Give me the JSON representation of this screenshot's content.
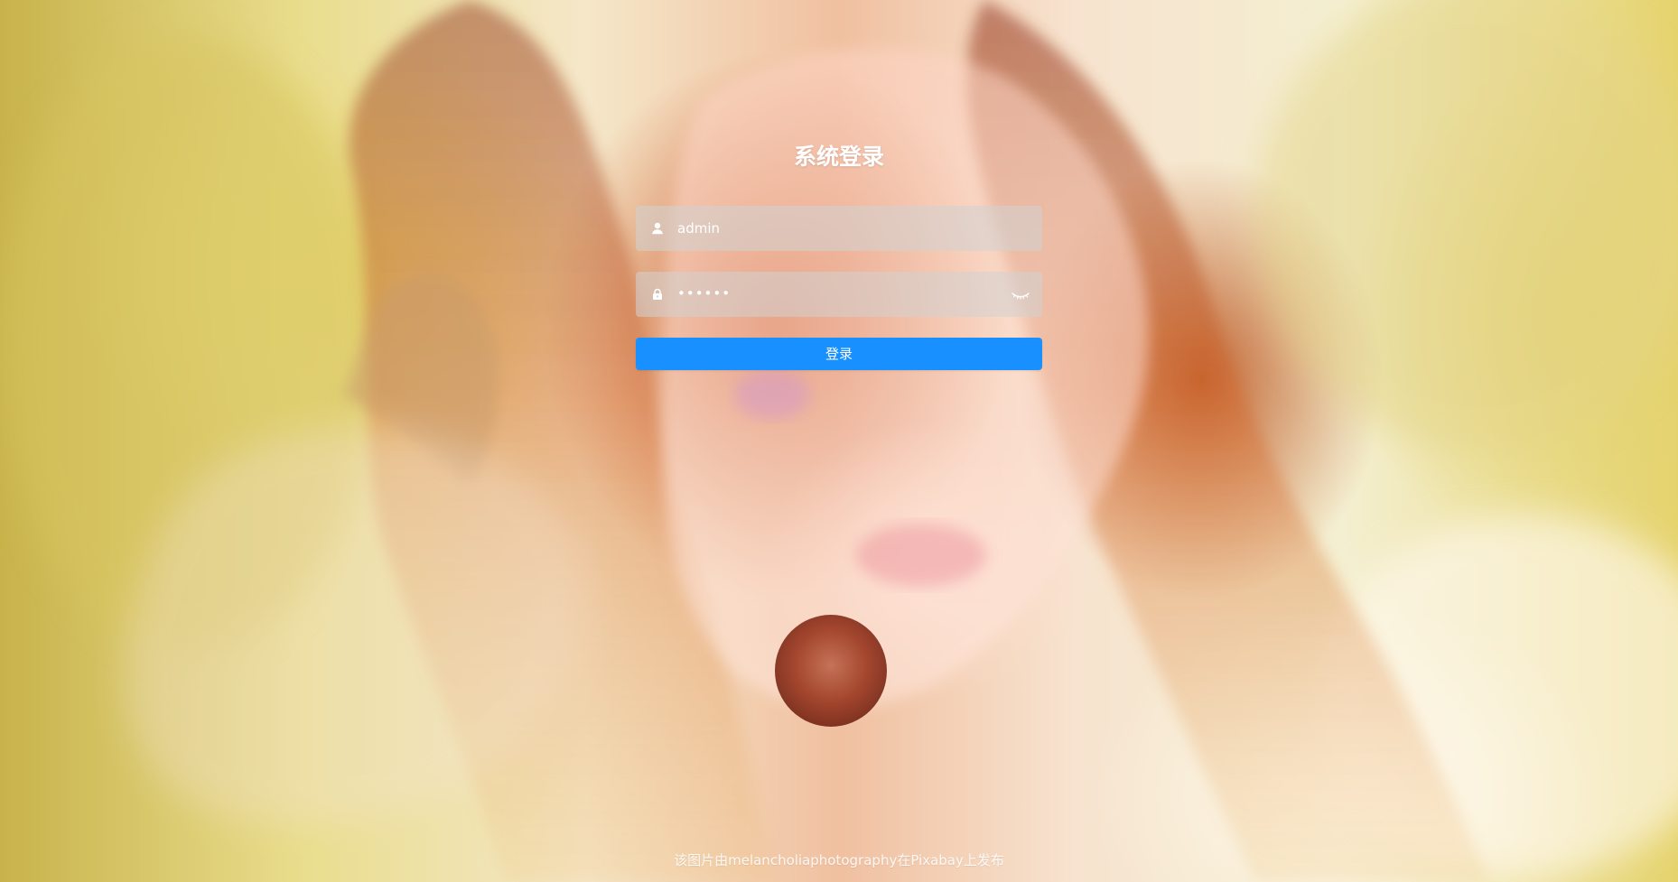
{
  "page": {
    "title": "系统登录",
    "footer_credit": "该图片由melancholiaphotography在Pixabay上发布"
  },
  "form": {
    "username": {
      "value": "admin",
      "icon": "user-icon"
    },
    "password": {
      "masked_value": "••••••",
      "icon": "lock-icon",
      "toggle_icon": "eye-closed-icon"
    },
    "submit_label": "登录"
  },
  "colors": {
    "primary": "#1890ff",
    "input_overlay": "rgba(210,210,210,0.55)",
    "text": "#ffffff"
  }
}
